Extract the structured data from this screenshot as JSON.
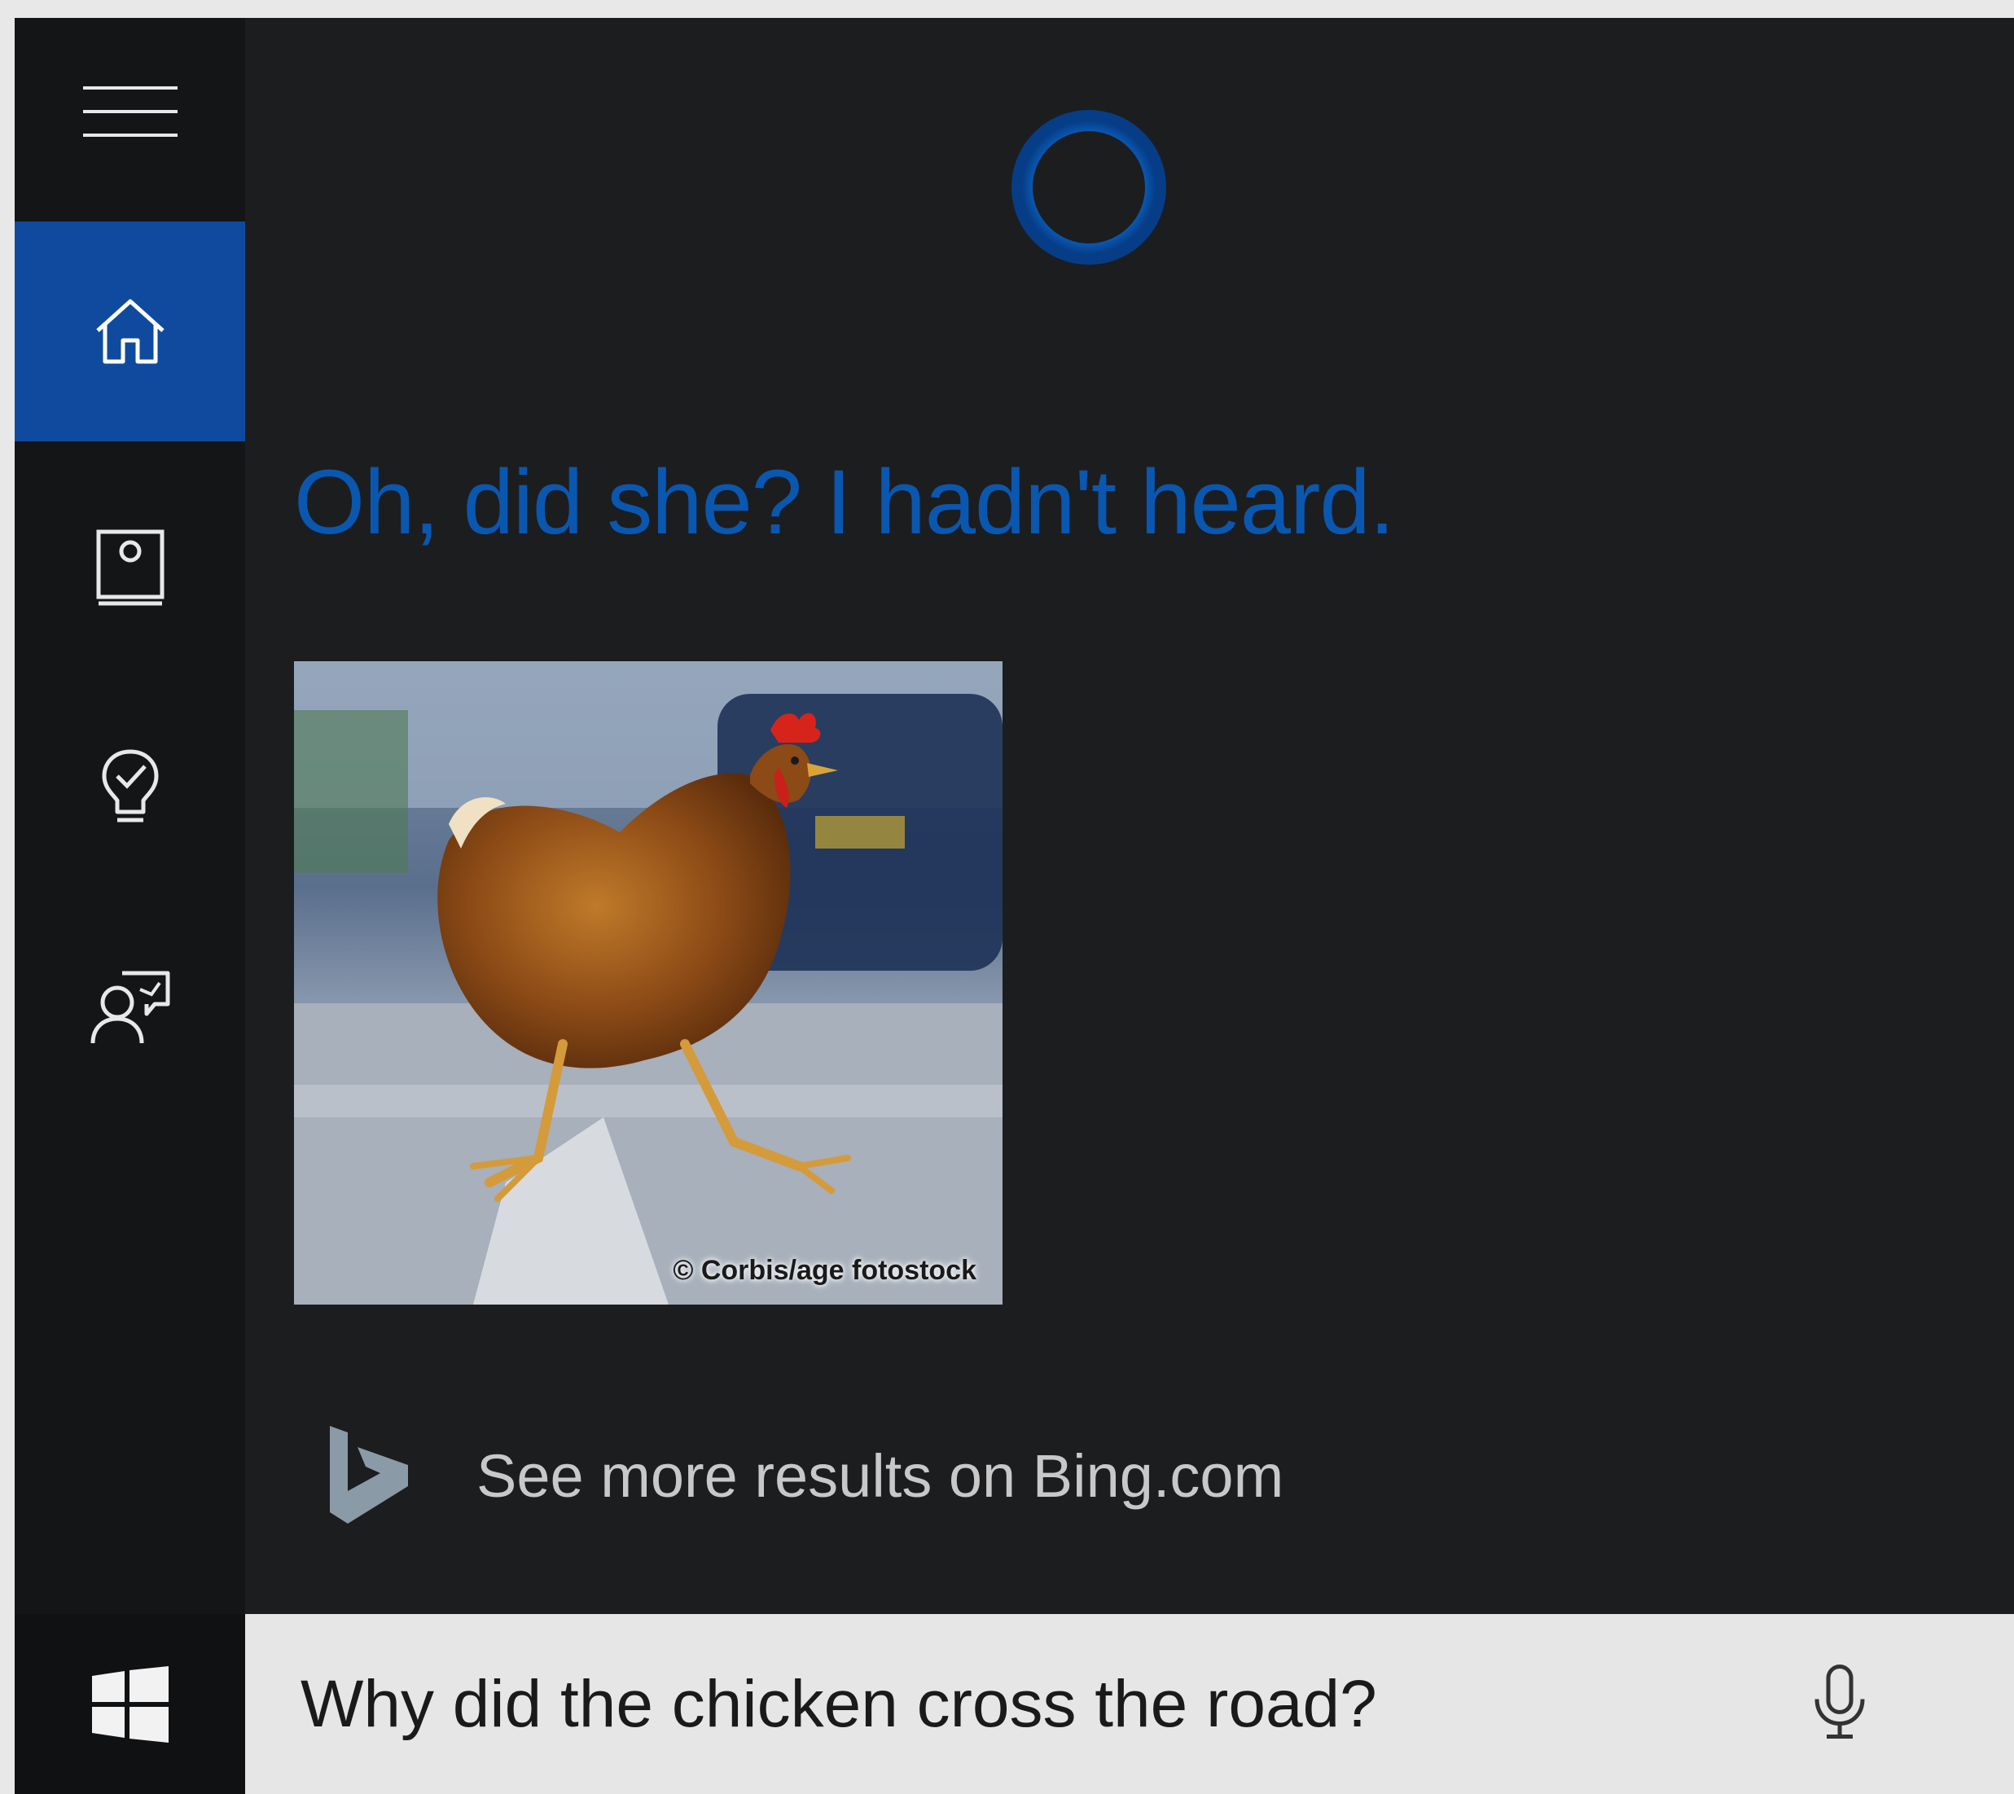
{
  "sidebar": {
    "items": [
      {
        "name": "home",
        "icon": "home-icon",
        "active": true
      },
      {
        "name": "notebook",
        "icon": "notebook-icon",
        "active": false
      },
      {
        "name": "reminders",
        "icon": "lightbulb-icon",
        "active": false
      },
      {
        "name": "feedback",
        "icon": "feedback-icon",
        "active": false
      }
    ]
  },
  "main": {
    "answer_text": "Oh, did she? I hadn't heard.",
    "image_credit": "© Corbis/age fotostock",
    "bing_link_text": "See more results on Bing.com"
  },
  "search": {
    "query": "Why did the chicken cross the road?"
  },
  "colors": {
    "accent": "#0f4a9e",
    "answer_text": "#0a57b0",
    "background": "#1c1d1f"
  }
}
